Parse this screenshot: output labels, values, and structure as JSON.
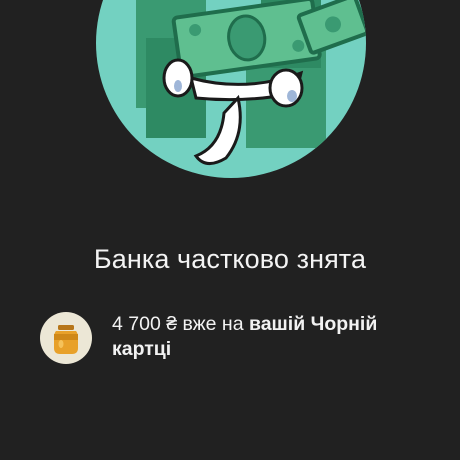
{
  "banner": {
    "title": "Банка частково знята"
  },
  "notice": {
    "amount": "4 700 ₴ вже на",
    "card_line_1": "вашій Чорній",
    "card_line_2": "картці",
    "icon": "honey-jar-icon"
  },
  "colors": {
    "background": "#212121",
    "hero_circle": "#73d1c1",
    "money": "#2e8a63",
    "jar_bg": "#ece7d6",
    "jar_honey": "#e8a12a"
  }
}
